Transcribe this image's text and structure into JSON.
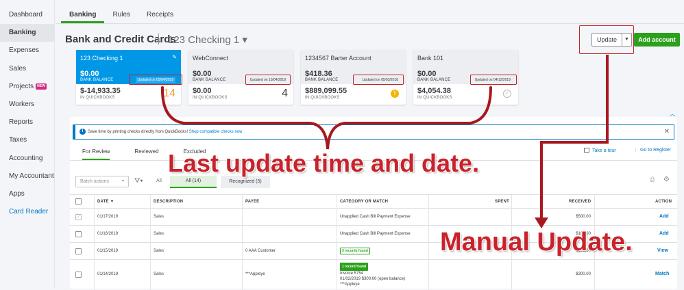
{
  "sidebar": {
    "items": [
      {
        "label": "Dashboard"
      },
      {
        "label": "Banking"
      },
      {
        "label": "Expenses"
      },
      {
        "label": "Sales"
      },
      {
        "label": "Projects",
        "badge": "NEW"
      },
      {
        "label": "Workers"
      },
      {
        "label": "Reports"
      },
      {
        "label": "Taxes"
      },
      {
        "label": "Accounting"
      },
      {
        "label": "My Accountant"
      },
      {
        "label": "Apps"
      },
      {
        "label": "Card Reader"
      }
    ]
  },
  "topnav": {
    "tabs": [
      {
        "label": "Banking"
      },
      {
        "label": "Rules"
      },
      {
        "label": "Receipts"
      }
    ]
  },
  "header": {
    "title": "Bank and Credit Cards",
    "account": "123 Checking 1 ▾",
    "update_label": "Update",
    "add_account_label": "Add account"
  },
  "cards": [
    {
      "name": "123 Checking 1",
      "bank_balance": "$0.00",
      "bank_label": "BANK BALANCE",
      "updated": "Updated on 05/04/2019",
      "qb_balance": "$-14,933.35",
      "qb_label": "IN QUICKBOOKS",
      "count": "14"
    },
    {
      "name": "WebConnect",
      "bank_balance": "$0.00",
      "bank_label": "BANK BALANCE",
      "updated": "Updated on 10/04/2018",
      "qb_balance": "$0.00",
      "qb_label": "IN QUICKBOOKS",
      "count": "4"
    },
    {
      "name": "1234567 Barter Account",
      "bank_balance": "$418.36",
      "bank_label": "BANK BALANCE",
      "updated": "Updated on 05/03/2018",
      "qb_balance": "$889,099.55",
      "qb_label": "IN QUICKBOOKS",
      "count": "!"
    },
    {
      "name": "Bank 101",
      "bank_balance": "$0.00",
      "bank_label": "BANK BALANCE",
      "updated": "Updated on 04/12/2019",
      "qb_balance": "$4,054.38",
      "qb_label": "IN QUICKBOOKS",
      "count": "✓"
    }
  ],
  "banner": {
    "text": "Save time by printing checks directly from QuickBooks!",
    "link": "Shop compatible checks now"
  },
  "subtabs": [
    {
      "label": "For Review"
    },
    {
      "label": "Reviewed"
    },
    {
      "label": "Excluded"
    }
  ],
  "links": {
    "tour": "Take a tour",
    "register": "Go to Register"
  },
  "filters": {
    "batch": "Batch actions",
    "all": "All",
    "all_pill": "All (14)",
    "recognized": "Recognized (5)"
  },
  "table": {
    "headers": [
      "DATE ▼",
      "DESCRIPTION",
      "PAYEE",
      "CATEGORY OR MATCH",
      "SPENT",
      "RECEIVED",
      "ACTION"
    ],
    "rows": [
      {
        "date": "01/17/2019",
        "description": "Sales",
        "payee": "",
        "category": "Unapplied Cash Bill Payment Expense",
        "tag": "",
        "match_lines": [],
        "spent": "",
        "received": "$500.00",
        "action": "Add"
      },
      {
        "date": "01/16/2019",
        "description": "Sales",
        "payee": "",
        "category": "Unapplied Cash Bill Payment Expense",
        "tag": "",
        "match_lines": [],
        "spent": "",
        "received": "$100.00",
        "action": "Add"
      },
      {
        "date": "01/15/2019",
        "description": "Sales",
        "payee": "0 AAA Customer",
        "category": "",
        "tag": "3 records found",
        "match_lines": [],
        "spent": "",
        "received": "$200.00",
        "action": "View"
      },
      {
        "date": "01/14/2019",
        "description": "Sales",
        "payee": "***Appleye",
        "category": "",
        "tag": "1 record found",
        "match_lines": [
          "Invoice 5754",
          "01/02/2019 $300.00 (open balance)",
          "***Appleye"
        ],
        "spent": "",
        "received": "$300.00",
        "action": "Match"
      }
    ]
  },
  "annotations": {
    "time_date": "Last update time and date.",
    "manual": "Manual Update."
  },
  "colors": {
    "accent_green": "#2ca01c",
    "selected_card": "#0097e6",
    "link_blue": "#0077c5",
    "annotation_red": "#c0252c"
  }
}
